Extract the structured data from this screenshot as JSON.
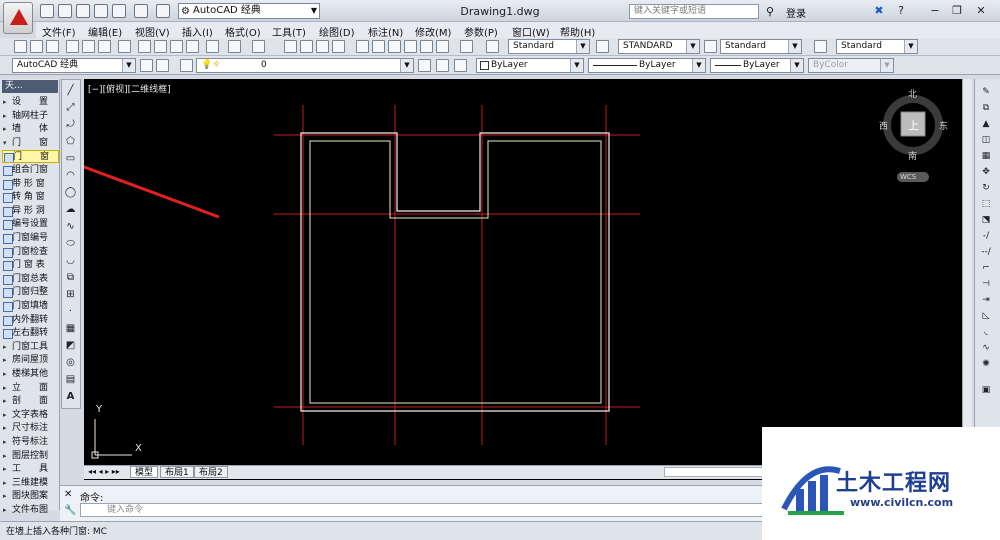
{
  "window": {
    "title": "Drawing1.dwg",
    "workspace": "AutoCAD 经典",
    "search_placeholder": "键入关键字或短语",
    "login_label": "登录"
  },
  "menu": [
    "文件(F)",
    "编辑(E)",
    "视图(V)",
    "插入(I)",
    "格式(O)",
    "工具(T)",
    "绘图(D)",
    "标注(N)",
    "修改(M)",
    "参数(P)",
    "窗口(W)",
    "帮助(H)"
  ],
  "toolbar1": {
    "text_style": "Standard",
    "dim_style": "STANDARD",
    "table_style": "Standard",
    "multileader_style": "Standard"
  },
  "toolbar2": {
    "workspace": "AutoCAD 经典",
    "layer": "0",
    "color": "ByLayer",
    "linetype": "ByLayer",
    "lineweight": "ByLayer",
    "plotstyle": "ByColor"
  },
  "left_panel": {
    "header": "天...",
    "items": [
      {
        "label": "设　　置",
        "icon": "arrow-right",
        "selected": false
      },
      {
        "label": "轴网柱子",
        "icon": "arrow-right",
        "selected": false
      },
      {
        "label": "墙　　体",
        "icon": "arrow-right",
        "selected": false
      },
      {
        "label": "门　　窗",
        "icon": "arrow-down",
        "selected": false
      },
      {
        "label": "门　　窗",
        "icon": "door-icon",
        "selected": true
      },
      {
        "label": "组合门窗",
        "icon": "window-icon",
        "selected": false
      },
      {
        "label": "带 形 窗",
        "icon": "window-icon",
        "selected": false
      },
      {
        "label": "转 角 窗",
        "icon": "window-icon",
        "selected": false
      },
      {
        "label": "异 形 洞",
        "icon": "hole-icon",
        "selected": false
      },
      {
        "label": "编号设置",
        "icon": "setting-icon",
        "selected": false
      },
      {
        "label": "门窗编号",
        "icon": "setting-icon",
        "selected": false
      },
      {
        "label": "门窗检查",
        "icon": "check-icon",
        "selected": false
      },
      {
        "label": "门 窗 表",
        "icon": "table-icon",
        "selected": false
      },
      {
        "label": "门窗总表",
        "icon": "table-icon",
        "selected": false
      },
      {
        "label": "门窗归整",
        "icon": "tool-icon",
        "selected": false
      },
      {
        "label": "门窗填墙",
        "icon": "tool-icon",
        "selected": false
      },
      {
        "label": "内外翻转",
        "icon": "flip-icon",
        "selected": false
      },
      {
        "label": "左右翻转",
        "icon": "flip-icon",
        "selected": false
      },
      {
        "label": "门窗工具",
        "icon": "arrow-right",
        "selected": false
      },
      {
        "label": "房间屋顶",
        "icon": "arrow-right",
        "selected": false
      },
      {
        "label": "楼梯其他",
        "icon": "arrow-right",
        "selected": false
      },
      {
        "label": "立　　面",
        "icon": "arrow-right",
        "selected": false
      },
      {
        "label": "剖　　面",
        "icon": "arrow-right",
        "selected": false
      },
      {
        "label": "文字表格",
        "icon": "arrow-right",
        "selected": false
      },
      {
        "label": "尺寸标注",
        "icon": "arrow-right",
        "selected": false
      },
      {
        "label": "符号标注",
        "icon": "arrow-right",
        "selected": false
      },
      {
        "label": "图层控制",
        "icon": "arrow-right",
        "selected": false
      },
      {
        "label": "工　　具",
        "icon": "arrow-right",
        "selected": false
      },
      {
        "label": "三维建模",
        "icon": "arrow-right",
        "selected": false
      },
      {
        "label": "图块图案",
        "icon": "arrow-right",
        "selected": false
      },
      {
        "label": "文件布图",
        "icon": "arrow-right",
        "selected": false
      }
    ]
  },
  "canvas": {
    "view_label": "[−][俯视][二维线框]",
    "viewcube": {
      "north": "北",
      "south": "南",
      "east": "东",
      "west": "西",
      "top": "上",
      "wcs": "WCS"
    },
    "ucs": {
      "x": "X",
      "y": "Y"
    },
    "colors": {
      "axis": "#c61b1b",
      "wall": "#f2f2f2",
      "inner": "#d9e8a0",
      "arrow": "#e12020"
    }
  },
  "tabs": [
    "模型",
    "布局1",
    "布局2"
  ],
  "command": {
    "label": "命令:",
    "placeholder": "键入命令"
  },
  "status": "在墙上插入各种门窗: MC",
  "watermark": {
    "title": "土木工程网",
    "url": "www.civilcn.com"
  }
}
